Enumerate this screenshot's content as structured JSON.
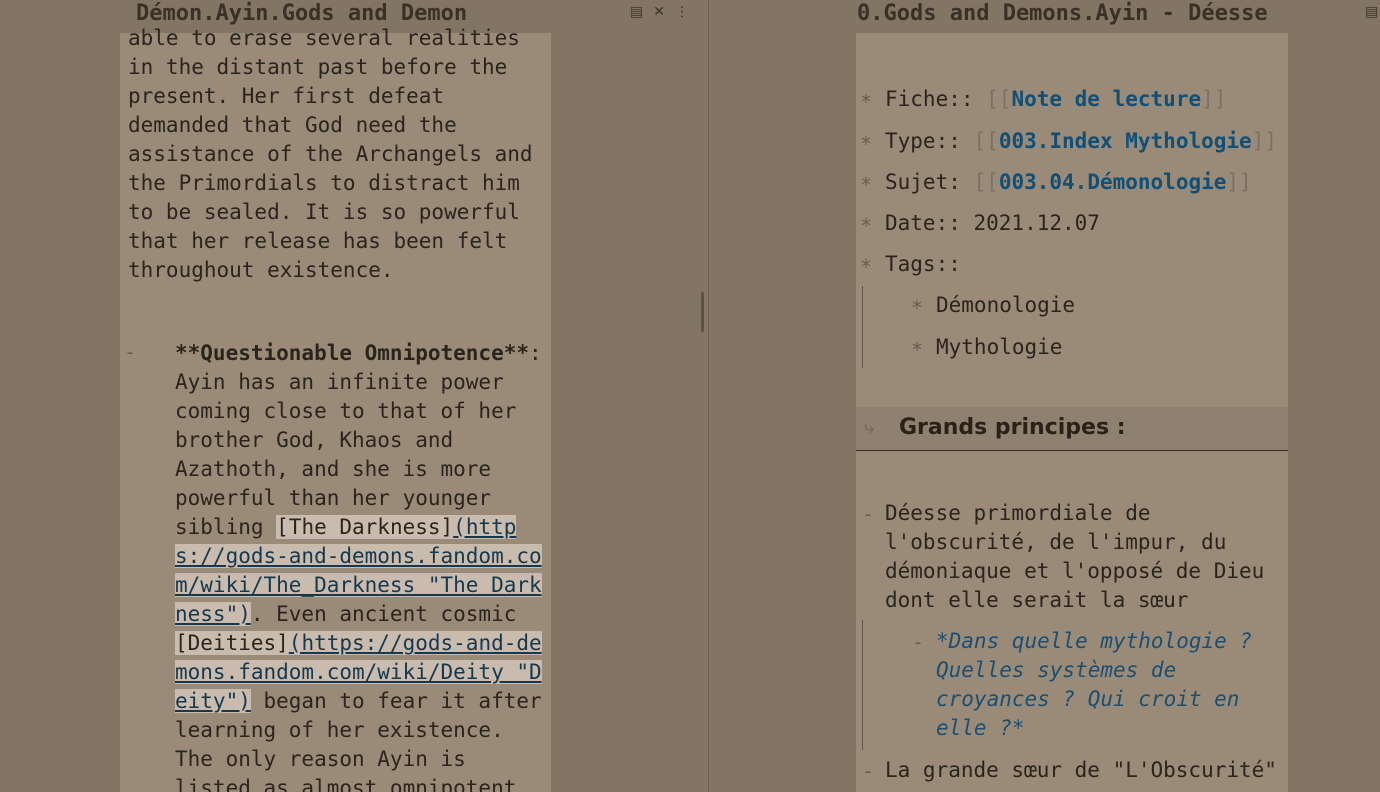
{
  "left_pane": {
    "title": "Démon.Ayin.Gods and Demon",
    "icons": [
      "reading-view-icon",
      "close-icon",
      "more-options-icon"
    ],
    "paragraph_lines": [
      "able to erase several realities",
      "in the distant past before the",
      "present. Her first defeat",
      "demanded that God need the",
      "assistance of the Archangels and",
      "the Primordials to distract him",
      "to be sealed. It is so powerful",
      "that her release has been felt",
      "throughout existence."
    ],
    "bullet_marker": "-",
    "omni": {
      "heading": "**Questionable Omnipotence**",
      "heading_colon": ":",
      "line1": "Ayin has an infinite power",
      "line2": "coming close to that of her",
      "line3": "brother God, Khaos and",
      "line4": "Azathoth, and she is more",
      "line5": "powerful than her younger",
      "line6_prefix": "sibling ",
      "link1_text": "[The Darkness]",
      "link1_url_a": "(http",
      "link1_url_b": "s://gods-and-demons.fandom.co",
      "link1_url_c": "m/wiki/The_Darkness \"The Dark",
      "link1_url_d": "ness\")",
      "line10_suffix": ". Even ancient cosmic",
      "link2_text": "[Deities]",
      "link2_url_a": "(https://gods-and-de",
      "link2_url_b": "mons.fandom.com/wiki/Deity \"D",
      "link2_url_c": "eity\")",
      "line13_suffix": " began to fear it after",
      "line14": "learning of her existence.",
      "line15": "The only reason Ayin is",
      "line16": "listed as almost omnipotent"
    }
  },
  "right_pane": {
    "title": "0.Gods and Demons.Ayin - Déesse",
    "icons": [
      "reading-view-icon"
    ],
    "star": "*",
    "open_br": "[[",
    "close_br": "]]",
    "meta": {
      "fiche_label": "Fiche:: ",
      "fiche_link": "Note de lecture",
      "type_label": "Type:: ",
      "type_link": "003.Index Mythologie",
      "sujet_label": "Sujet: ",
      "sujet_link": "003.04.Démonologie",
      "date_label": "Date:: 2021.12.07",
      "tags_label": "Tags::",
      "tag1": "Démonologie",
      "tag2": "Mythologie"
    },
    "heading": "Grands principes :",
    "dash": "-",
    "body": {
      "p1_l1": "Déesse primordiale de",
      "p1_l2": "l'obscurité, de l'impur, du",
      "p1_l3": "démoniaque et l'opposé de Dieu",
      "p1_l4": "dont elle serait la sœur",
      "q_l1": "*Dans quelle mythologie ?",
      "q_l2": "Quelles systèmes de",
      "q_l3": "croyances ? Qui croit en",
      "q_l4": "elle ?*",
      "p2_l1": "La grande sœur de \"L'Obscurité\""
    }
  },
  "colors": {
    "background": "#827564",
    "sheet": "#9a8b79",
    "wikilink": "#0f4f78",
    "link_chip": "#c9bcae"
  }
}
